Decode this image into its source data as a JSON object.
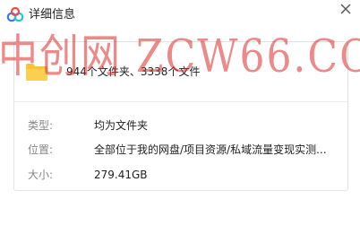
{
  "window": {
    "title": "详细信息"
  },
  "summary": {
    "counts": "944个文件夹、3338个文件"
  },
  "details": {
    "type_label": "类型:",
    "type_value": "均为文件夹",
    "location_label": "位置:",
    "location_value": "全部位于我的网盘/项目资源/私域流量变现实测...",
    "size_label": "大小:",
    "size_value": "279.41GB"
  },
  "watermark": {
    "text": "中创网 ZCW66.COM"
  },
  "colors": {
    "accent": "#2f7cf6",
    "folder": "#f8c23a",
    "watermark": "#dc2828"
  },
  "icons": {
    "logo": "baidu-netdisk-logo-icon",
    "close": "close-icon",
    "folder": "folder-icon"
  }
}
